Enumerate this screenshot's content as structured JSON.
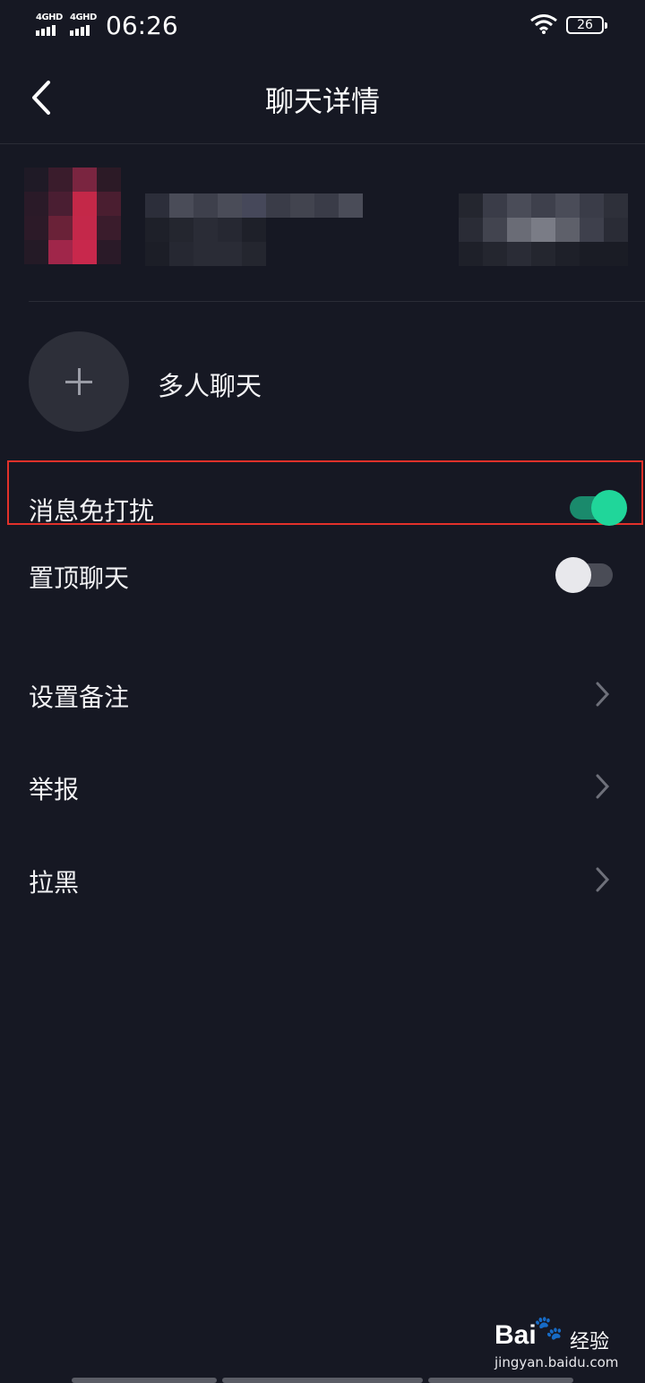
{
  "status_bar": {
    "network1": "4GHD",
    "network2": "4GHD",
    "time": "06:26",
    "battery": "26"
  },
  "header": {
    "title": "聊天详情",
    "back_icon": "chevron-left-icon"
  },
  "group_chat": {
    "label": "多人聊天",
    "icon": "plus-icon"
  },
  "settings": [
    {
      "label": "消息免打扰",
      "control": "toggle",
      "on": true
    },
    {
      "label": "置顶聊天",
      "control": "toggle",
      "on": false
    },
    {
      "label": "设置备注",
      "control": "chevron"
    },
    {
      "label": "举报",
      "control": "chevron"
    },
    {
      "label": "拉黑",
      "control": "chevron"
    }
  ],
  "watermark": {
    "brand": "Bai",
    "brand_cn": "经验",
    "url": "jingyan.baidu.com"
  },
  "colors": {
    "background": "#161823",
    "toggle_on": "#20d69a",
    "highlight_border": "#e2312a"
  }
}
